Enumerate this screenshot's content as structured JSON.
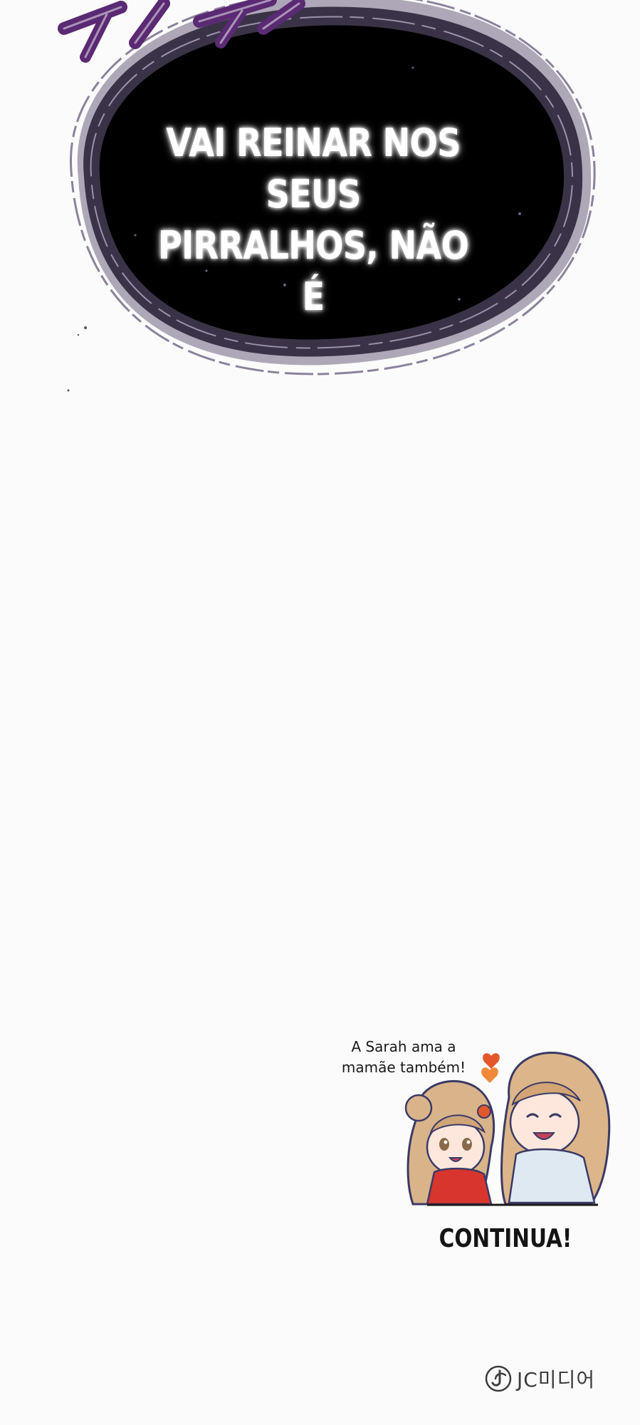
{
  "speech_blob": {
    "text_line1": "VAI REINAR NOS SEUS",
    "text_line2": "PIRRALHOS, NÃO É",
    "fill_color": "#000000",
    "rim_color": "#5b4f6e"
  },
  "sfx": {
    "text": "",
    "color": "#5a2a73"
  },
  "bonus": {
    "caption_line1": "A Sarah ama a",
    "caption_line2": "mamãe também!",
    "heart_color": "#e2572b"
  },
  "ending": {
    "label": "CONTINUA!"
  },
  "publisher": {
    "name": "JC미디어",
    "logo_icon": "jc-media-logo-icon"
  },
  "colors": {
    "background": "#fbfbfb",
    "text_dark": "#141414"
  }
}
